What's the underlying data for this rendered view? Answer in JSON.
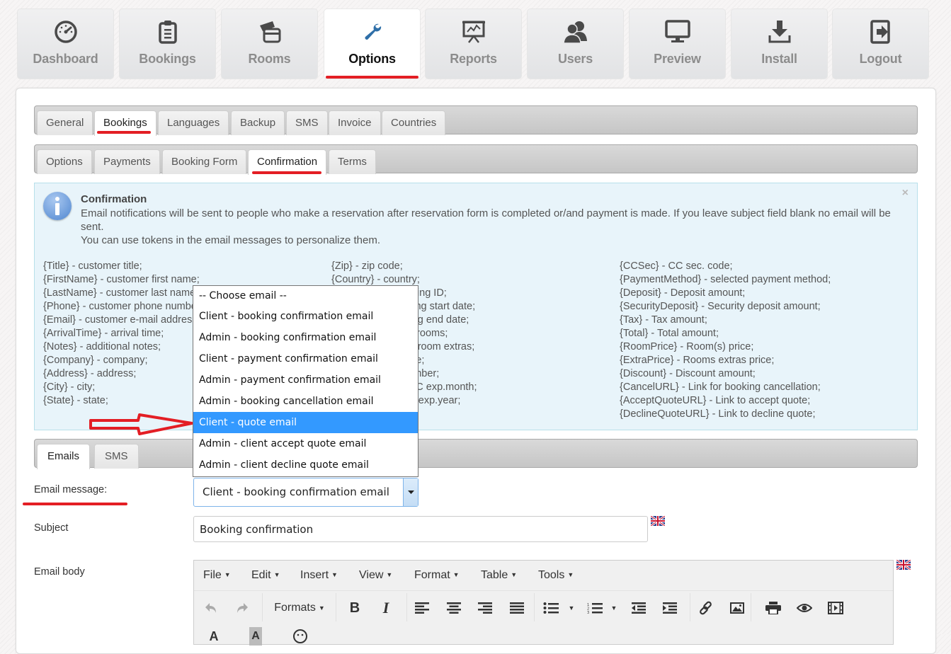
{
  "topnav": {
    "items": [
      {
        "label": "Dashboard",
        "icon": "dashboard-gauge-icon",
        "active": false
      },
      {
        "label": "Bookings",
        "icon": "clipboard-icon",
        "active": false
      },
      {
        "label": "Rooms",
        "icon": "credit-cards-icon",
        "active": false
      },
      {
        "label": "Options",
        "icon": "wrench-icon",
        "active": true
      },
      {
        "label": "Reports",
        "icon": "presentation-chart-icon",
        "active": false
      },
      {
        "label": "Users",
        "icon": "users-icon",
        "active": false
      },
      {
        "label": "Preview",
        "icon": "monitor-icon",
        "active": false
      },
      {
        "label": "Install",
        "icon": "download-icon",
        "active": false
      },
      {
        "label": "Logout",
        "icon": "logout-icon",
        "active": false
      }
    ]
  },
  "main_tabs": [
    "General",
    "Bookings",
    "Languages",
    "Backup",
    "SMS",
    "Invoice",
    "Countries"
  ],
  "main_tabs_active": "Bookings",
  "sub_tabs": [
    "Options",
    "Payments",
    "Booking Form",
    "Confirmation",
    "Terms"
  ],
  "sub_tabs_active": "Confirmation",
  "info": {
    "title": "Confirmation",
    "message_line1": "Email notifications will be sent to people who make a reservation after reservation form is completed or/and payment is made. If you leave subject field blank no email will be sent.",
    "message_line2": "You can use tokens in the email messages to personalize them.",
    "close": "×",
    "tokens_col1": [
      "{Title} - customer title;",
      "{FirstName} - customer first name;",
      "{LastName} - customer last name;",
      "{Phone} - customer phone number;",
      "{Email} - customer e-mail address;",
      "{ArrivalTime} - arrival time;",
      "{Notes} - additional notes;",
      "{Company} - company;",
      "{Address} - address;",
      "{City} - city;",
      "{State} - state;"
    ],
    "tokens_col2": [
      "{Zip} - zip code;",
      "{Country} - country;",
      "{BookingID} - booking ID;",
      "{StartDate} - booking start date;",
      "{EndDate} - booking end date;",
      "{Rooms} - booked rooms;",
      "{Extras} - selected room extras;",
      "{CCType} - CC type;",
      "{CCNum} - CC number;",
      "{CCExpMonth} - CC exp.month;",
      "{CCExpYear} - CC exp.year;"
    ],
    "tokens_col3": [
      "{CCSec} - CC sec. code;",
      "{PaymentMethod} - selected payment method;",
      "{Deposit} - Deposit amount;",
      "{SecurityDeposit} - Security deposit amount;",
      "{Tax} - Tax amount;",
      "{Total} - Total amount;",
      "{RoomPrice} - Room(s) price;",
      "{ExtraPrice} - Rooms extras price;",
      "{Discount} - Discount amount;",
      "{CancelURL} - Link for booking cancellation;",
      "{AcceptQuoteURL} - Link to accept quote;",
      "{DeclineQuoteURL} - Link to decline quote;"
    ]
  },
  "message_tabs": [
    "Emails",
    "SMS"
  ],
  "message_tabs_active": "Emails",
  "form": {
    "email_message_label": "Email message:",
    "email_message_value": "Client - booking confirmation email",
    "email_options": [
      "-- Choose email --",
      "Client - booking confirmation email",
      "Admin - booking confirmation email",
      "Client - payment confirmation email",
      "Admin - payment confirmation email",
      "Admin - booking cancellation email",
      "Client - quote email",
      "Admin - client accept quote email",
      "Admin - client decline quote email"
    ],
    "highlighted_option": "Client - quote email",
    "subject_label": "Subject",
    "subject_value": "Booking confirmation",
    "body_label": "Email body",
    "language_flag": "uk-flag-icon"
  },
  "editor": {
    "menus": [
      "File",
      "Edit",
      "Insert",
      "View",
      "Format",
      "Table",
      "Tools"
    ],
    "formats_label": "Formats"
  },
  "colors": {
    "accent_red": "#e31e24",
    "highlight_blue": "#3399ff",
    "info_bg": "#e8f4fa"
  }
}
